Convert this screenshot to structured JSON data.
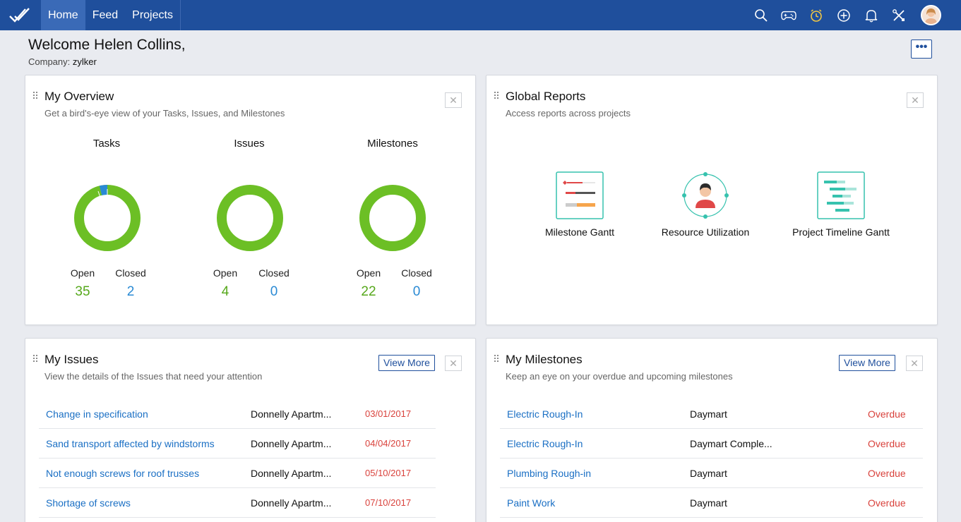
{
  "nav": {
    "items": [
      "Home",
      "Feed",
      "Projects"
    ],
    "active": "Home"
  },
  "header": {
    "welcome": "Welcome Helen Collins,",
    "company_label": "Company:",
    "company_name": "zylker",
    "more_label": "•••"
  },
  "top_icons": [
    "search-icon",
    "gamepad-icon",
    "timer-icon",
    "add-icon",
    "bell-icon",
    "tools-icon",
    "avatar"
  ],
  "colors": {
    "topbar": "#1f4f9c",
    "open": "#56a81b",
    "closed": "#2a8ad4",
    "overdue": "#d9423c",
    "link": "#1a6fc4"
  },
  "overview": {
    "title": "My Overview",
    "subtitle": "Get a bird's-eye view of your Tasks, Issues, and Milestones",
    "open_label": "Open",
    "closed_label": "Closed",
    "groups": [
      {
        "label": "Tasks",
        "open": "35",
        "closed": "2"
      },
      {
        "label": "Issues",
        "open": "4",
        "closed": "0"
      },
      {
        "label": "Milestones",
        "open": "22",
        "closed": "0"
      }
    ]
  },
  "reports": {
    "title": "Global Reports",
    "subtitle": "Access reports across projects",
    "items": [
      "Milestone Gantt",
      "Resource Utilization",
      "Project Timeline Gantt"
    ]
  },
  "issues": {
    "title": "My Issues",
    "subtitle": "View the details of the Issues that need your attention",
    "view_more": "View More",
    "rows": [
      {
        "name": "Change in specification",
        "project": "Donnelly Apartm...",
        "date": "03/01/2017"
      },
      {
        "name": "Sand transport affected by windstorms",
        "project": "Donnelly Apartm...",
        "date": "04/04/2017"
      },
      {
        "name": "Not enough screws for roof trusses",
        "project": "Donnelly Apartm...",
        "date": "05/10/2017"
      },
      {
        "name": "Shortage of screws",
        "project": "Donnelly Apartm...",
        "date": "07/10/2017"
      }
    ]
  },
  "milestones": {
    "title": "My Milestones",
    "subtitle": "Keep an eye on your overdue and upcoming milestones",
    "view_more": "View More",
    "rows": [
      {
        "name": "Electric Rough-In",
        "project": "Daymart",
        "status": "Overdue"
      },
      {
        "name": "Electric Rough-In",
        "project": "Daymart Comple...",
        "status": "Overdue"
      },
      {
        "name": "Plumbing Rough-in",
        "project": "Daymart",
        "status": "Overdue"
      },
      {
        "name": "Paint Work",
        "project": "Daymart",
        "status": "Overdue"
      }
    ]
  },
  "close_glyph": "✕"
}
